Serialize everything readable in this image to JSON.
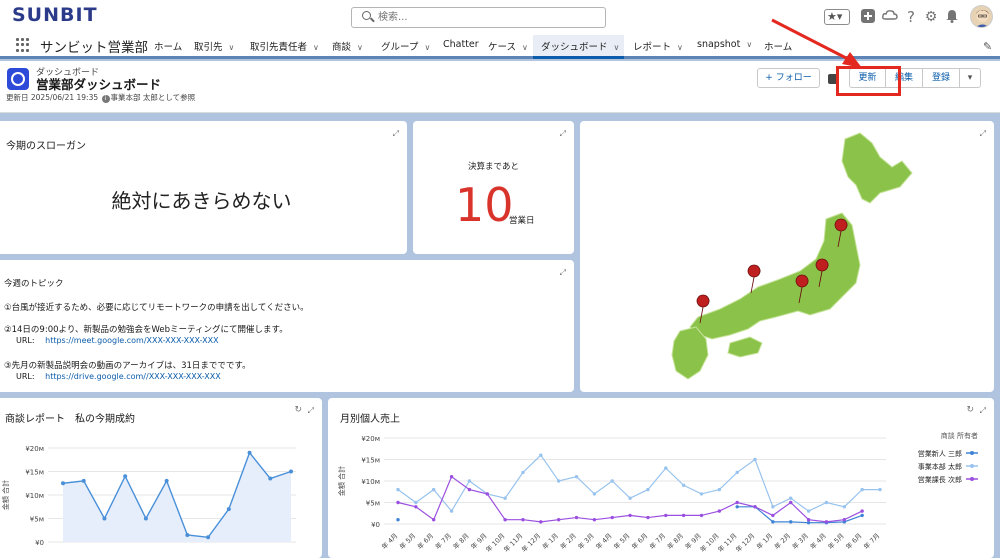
{
  "header": {
    "logo": "SUNBIT",
    "search_placeholder": "検索..."
  },
  "nav": {
    "app_name": "サンビット営業部",
    "items": [
      {
        "label": "ホーム",
        "chev": false
      },
      {
        "label": "取引先",
        "chev": true
      },
      {
        "label": "取引先責任者",
        "chev": true
      },
      {
        "label": "商談",
        "chev": true
      },
      {
        "label": "グループ",
        "chev": true
      },
      {
        "label": "Chatter",
        "chev": false
      },
      {
        "label": "ケース",
        "chev": true
      },
      {
        "label": "ダッシュボード",
        "chev": true,
        "active": true
      },
      {
        "label": "レポート",
        "chev": true
      },
      {
        "label": "snapshot",
        "chev": true
      },
      {
        "label": "ホーム",
        "chev": false
      }
    ]
  },
  "dashboard": {
    "type_label": "ダッシュボード",
    "title": "営業部ダッシュボード",
    "meta": "更新日 2025/06/21 19:35",
    "viewing_as": "事業本部 太郎として参照",
    "follow_label": "+ フォロー",
    "refresh_label": "更新",
    "edit_label": "編集",
    "subscribe_label": "登録"
  },
  "slogan": {
    "title": "今期のスローガン",
    "text": "絶対にあきらめない"
  },
  "countdown": {
    "label": "決算まであと",
    "value": "10",
    "unit": "営業日"
  },
  "topics": {
    "title": "今週のトピック",
    "line1": "①台風が接近するため、必要に応じてリモートワークの申請を出してください。",
    "line2": "②14日の9:00より、新製品の勉強会をWebミーティングにて開催します。",
    "url_label": "URL:",
    "url1": "https://meet.google.com/XXX-XXX-XXX-XXX",
    "line3": "③先月の新製品説明会の動画のアーカイブは、31日まででです。",
    "url2": "https://drive.google.com//XXX-XXX-XXX-XXX"
  },
  "map": {
    "pins": 5
  },
  "chart_data": [
    {
      "type": "area",
      "title": "商談レポート　私の今期成約",
      "ylabel": "金額 合計",
      "y_ticks": [
        "¥20м",
        "¥15м",
        "¥10м",
        "¥5м",
        "¥0"
      ],
      "ylim": [
        0,
        20
      ],
      "values": [
        12.5,
        13,
        5,
        14,
        5,
        13,
        1.5,
        1,
        7,
        19,
        13.5,
        15
      ],
      "colors": {
        "line": "#4a90d9",
        "fill": "#e6eefb"
      }
    },
    {
      "type": "line",
      "title": "月別個人売上",
      "ylabel": "金額 合計",
      "legend_title": "商談 所有者",
      "legend_position": "right",
      "y_ticks": [
        "¥20м",
        "¥15м",
        "¥10м",
        "¥5м",
        "¥0"
      ],
      "ylim": [
        0,
        20
      ],
      "x_ticks": [
        "年 4月",
        "年 5月",
        "年 6月",
        "年 7月",
        "年 8月",
        "年 9月",
        "年 10月",
        "年 11月",
        "年 12月",
        "年 1月",
        "年 2月",
        "年 3月",
        "年 4月",
        "年 5月",
        "年 6月",
        "年 7月",
        "年 8月",
        "年 9月",
        "年 10月",
        "年 11月",
        "年 12月",
        "年 1月",
        "年 2月",
        "年 3月",
        "年 4月",
        "年 5月",
        "年 6月",
        "年 7月"
      ],
      "series": [
        {
          "name": "営業新人 三郎",
          "color": "#3f84d6",
          "values": [
            1,
            null,
            null,
            null,
            null,
            null,
            null,
            null,
            null,
            null,
            null,
            null,
            null,
            null,
            null,
            null,
            null,
            null,
            null,
            4,
            4,
            0.5,
            0.5,
            0.3,
            0.3,
            0.5,
            2,
            null
          ]
        },
        {
          "name": "事業本部 太郎",
          "color": "#98c3ee",
          "values": [
            8,
            5,
            8,
            3,
            10,
            7,
            6,
            12,
            16,
            10,
            11,
            7,
            10,
            6,
            8,
            13,
            9,
            7,
            8,
            12,
            15,
            4,
            6,
            3,
            5,
            4,
            8,
            8
          ]
        },
        {
          "name": "営業課長 次郎",
          "color": "#9b4fe0",
          "values": [
            5,
            4,
            1,
            11,
            8,
            7,
            1,
            1,
            0.5,
            1,
            1.5,
            1,
            1.5,
            2,
            1.5,
            2,
            2,
            2,
            3,
            5,
            4,
            2,
            5,
            1,
            0.5,
            1,
            3,
            null
          ]
        }
      ]
    }
  ]
}
